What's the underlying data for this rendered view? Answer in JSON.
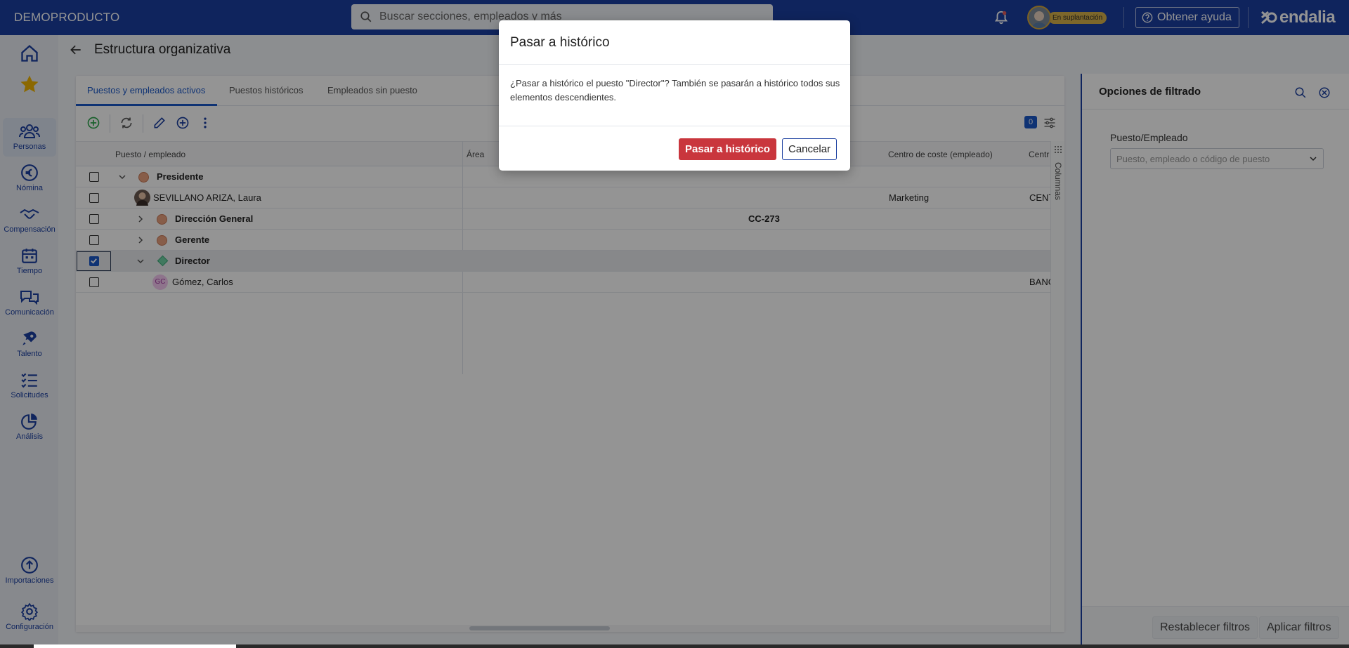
{
  "topbar": {
    "brand": "DEMOPRODUCTO",
    "search_placeholder": "Buscar secciones, empleados y más",
    "impersonation_badge": "En suplantación",
    "help_label": "Obtener ayuda",
    "logo_text": "endalia",
    "colors": {
      "bar": "#1b3fa0",
      "badge": "#d8b24a"
    }
  },
  "nav": {
    "items": [
      {
        "label": "",
        "icon": "home-icon"
      },
      {
        "label": "",
        "icon": "star-icon"
      },
      {
        "label": "Personas",
        "icon": "people-icon"
      },
      {
        "label": "Nómina",
        "icon": "euro-icon"
      },
      {
        "label": "Compensación",
        "icon": "handshake-icon"
      },
      {
        "label": "Tiempo",
        "icon": "calendar-icon"
      },
      {
        "label": "Comunicación",
        "icon": "chat-icon"
      },
      {
        "label": "Talento",
        "icon": "rocket-icon"
      },
      {
        "label": "Solicitudes",
        "icon": "checklist-icon"
      },
      {
        "label": "Análisis",
        "icon": "pie-chart-icon"
      }
    ],
    "bottom_items": [
      {
        "label": "Importaciones",
        "icon": "upload-icon"
      },
      {
        "label": "Configuración",
        "icon": "gear-icon"
      }
    ]
  },
  "page": {
    "title": "Estructura organizativa"
  },
  "tabs": [
    {
      "label": "Puestos y empleados activos",
      "active": true
    },
    {
      "label": "Puestos históricos",
      "active": false
    },
    {
      "label": "Empleados sin puesto",
      "active": false
    }
  ],
  "toolbar": {
    "selected_count": "0"
  },
  "table": {
    "columns": [
      "Puesto / empleado",
      "Área",
      "Centro de coste (empleado)",
      "Centr"
    ],
    "columns_toggle_label": "Columnas",
    "rows": [
      {
        "name": "Presidente",
        "type": "position",
        "area": "",
        "cost_center": "",
        "center": "",
        "checked": false
      },
      {
        "name": "SEVILLANO ARIZA, Laura",
        "type": "employee",
        "area": "",
        "cost_center": "Marketing",
        "center": "CENT",
        "checked": false
      },
      {
        "name": "Dirección General",
        "type": "position",
        "area": "CC-273",
        "cost_center": "",
        "center": "",
        "checked": false
      },
      {
        "name": "Gerente",
        "type": "position",
        "area": "",
        "cost_center": "",
        "center": "",
        "checked": false
      },
      {
        "name": "Director",
        "type": "position",
        "area": "",
        "cost_center": "",
        "center": "",
        "checked": true
      },
      {
        "name": "Gómez, Carlos",
        "type": "employee",
        "initials": "GC",
        "area": "",
        "cost_center": "",
        "center": "BANC",
        "checked": false
      }
    ]
  },
  "filters": {
    "title": "Opciones de filtrado",
    "field_label": "Puesto/Empleado",
    "field_placeholder": "Puesto, empleado o código de puesto",
    "reset_label": "Restablecer filtros",
    "apply_label": "Aplicar filtros"
  },
  "modal": {
    "title": "Pasar a histórico",
    "body": "¿Pasar a histórico el puesto \"Director\"? También se pasarán a histórico todos sus elementos descendientes.",
    "confirm_label": "Pasar a histórico",
    "cancel_label": "Cancelar",
    "colors": {
      "confirm": "#c9363d"
    }
  }
}
